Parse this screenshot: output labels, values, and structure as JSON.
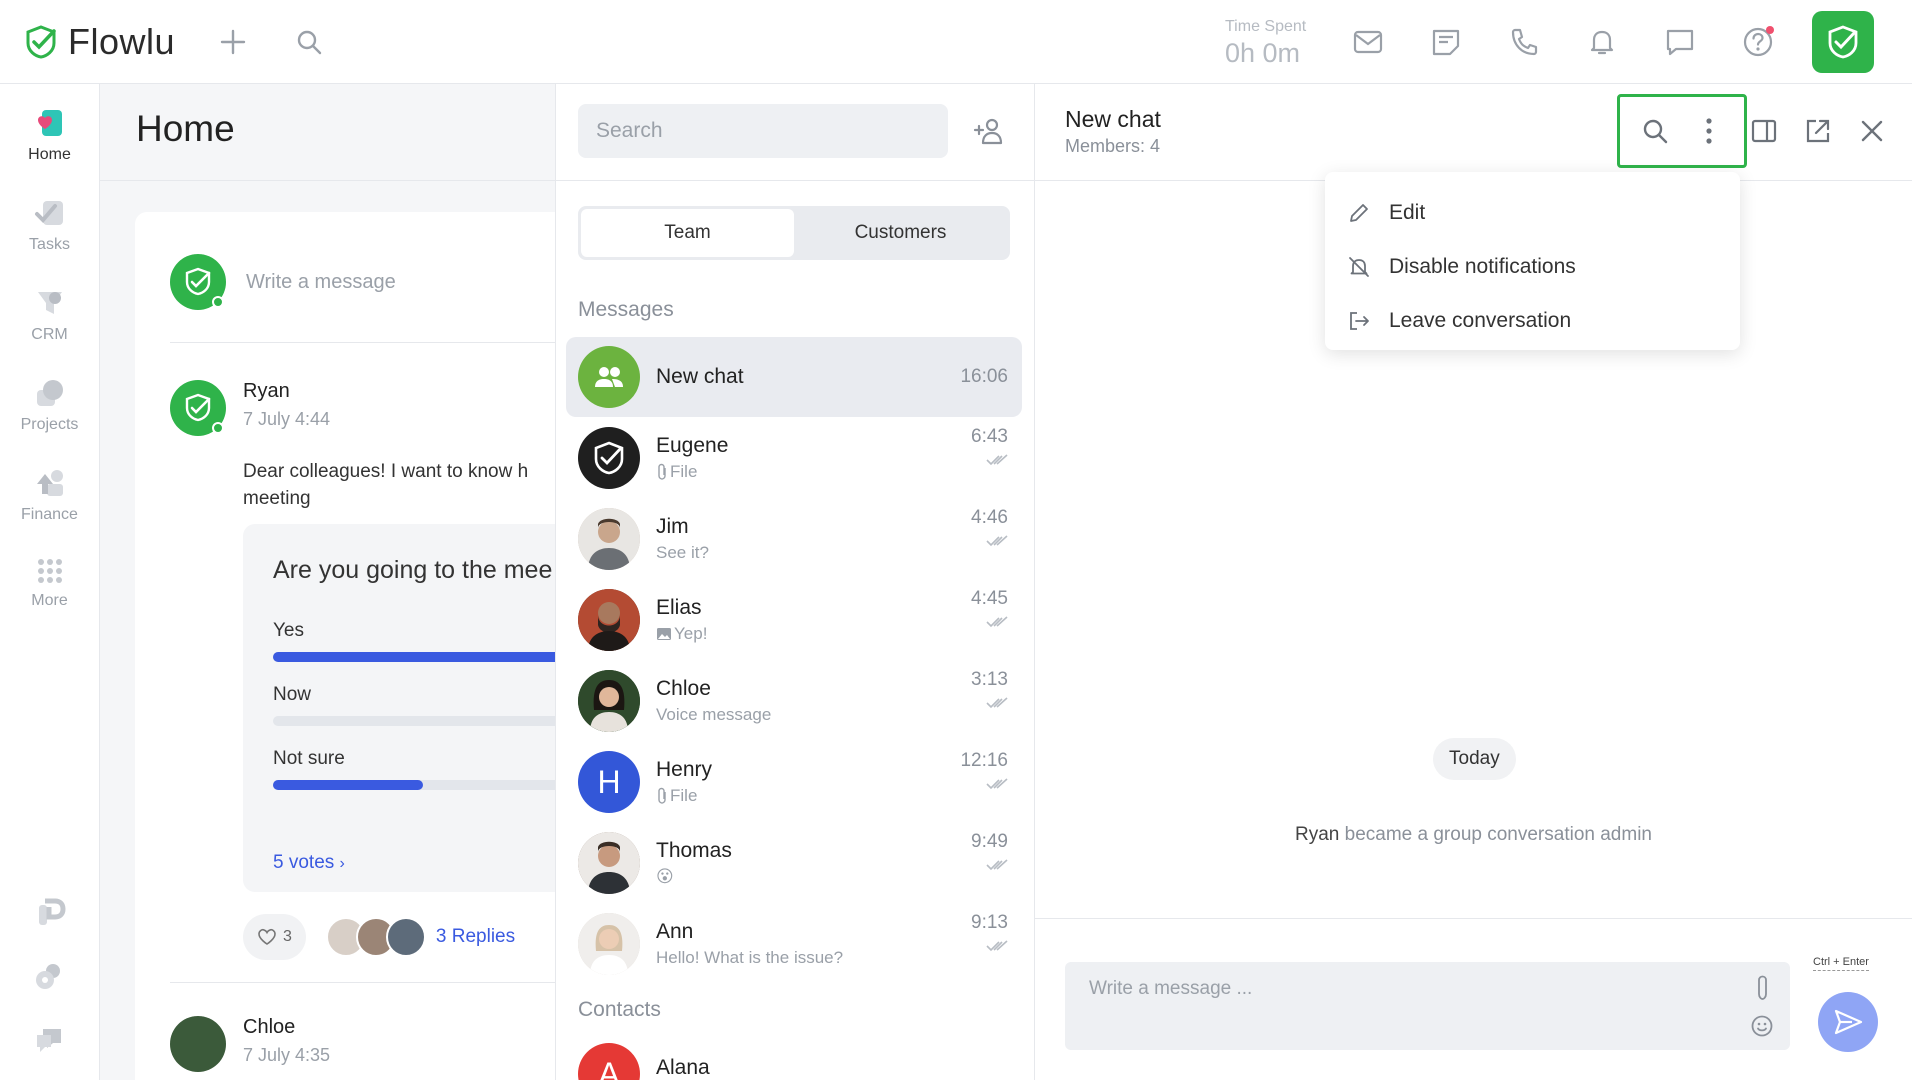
{
  "app": {
    "name": "Flowlu",
    "time_spent_label": "Time Spent",
    "time_spent_value": "0h 0m",
    "accent_color": "#2fb34a"
  },
  "nav": {
    "items": [
      {
        "label": "Home",
        "icon": "home-icon"
      },
      {
        "label": "Tasks",
        "icon": "tasks-icon"
      },
      {
        "label": "CRM",
        "icon": "crm-icon"
      },
      {
        "label": "Projects",
        "icon": "projects-icon"
      },
      {
        "label": "Finance",
        "icon": "finance-icon"
      },
      {
        "label": "More",
        "icon": "more-grid-icon"
      }
    ]
  },
  "home": {
    "title": "Home",
    "write_placeholder": "Write a message",
    "post": {
      "author": "Ryan",
      "date": "7 July 4:44",
      "text_line1": "Dear colleagues! I want to know h",
      "text_line2": "meeting",
      "poll": {
        "question": "Are you going to the mee",
        "options": [
          {
            "label": "Yes",
            "fill": 1.0
          },
          {
            "label": "Now",
            "fill": 0.0
          },
          {
            "label": "Not sure",
            "fill": 0.5
          }
        ],
        "votes": "5 votes"
      },
      "likes": "3",
      "replies": "3 Replies"
    },
    "post2": {
      "author": "Chloe",
      "date": "7 July 4:35"
    }
  },
  "chatlist": {
    "search_placeholder": "Search",
    "tabs": [
      "Team",
      "Customers"
    ],
    "messages_header": "Messages",
    "contacts_header": "Contacts",
    "chats": [
      {
        "name": "New chat",
        "preview": "",
        "time": "16:06",
        "avatar_color": "#6cb33f"
      },
      {
        "name": "Eugene",
        "preview": "File",
        "time": "6:43",
        "avatar_color": "#1f1f1f"
      },
      {
        "name": "Jim",
        "preview": "See it?",
        "time": "4:46",
        "avatar_color": "#c9b6a5"
      },
      {
        "name": "Elias",
        "preview": "Yep!",
        "time": "4:45",
        "avatar_color": "#5a4034"
      },
      {
        "name": "Chloe",
        "preview": "Voice message",
        "time": "3:13",
        "avatar_color": "#3b5a3a"
      },
      {
        "name": "Henry",
        "preview": "File",
        "time": "12:16",
        "avatar_color": "#3357d8",
        "initial": "H"
      },
      {
        "name": "Thomas",
        "preview": "😮",
        "time": "9:49",
        "avatar_color": "#8a7466"
      },
      {
        "name": "Ann",
        "preview": "Hello! What is the issue?",
        "time": "9:13",
        "avatar_color": "#d9cfc6"
      }
    ],
    "contacts": [
      {
        "name": "Alana",
        "initial": "A",
        "avatar_color": "#e53935"
      }
    ]
  },
  "conversation": {
    "title": "New chat",
    "members": "Members: 4",
    "menu": [
      {
        "label": "Edit",
        "icon": "pencil-icon"
      },
      {
        "label": "Disable notifications",
        "icon": "bell-off-icon"
      },
      {
        "label": "Leave conversation",
        "icon": "leave-icon"
      }
    ],
    "day_label": "Today",
    "system_actor": "Ryan",
    "system_text": " became a group conversation admin",
    "composer_placeholder": "Write a message ...",
    "send_hint": "Ctrl + Enter"
  }
}
